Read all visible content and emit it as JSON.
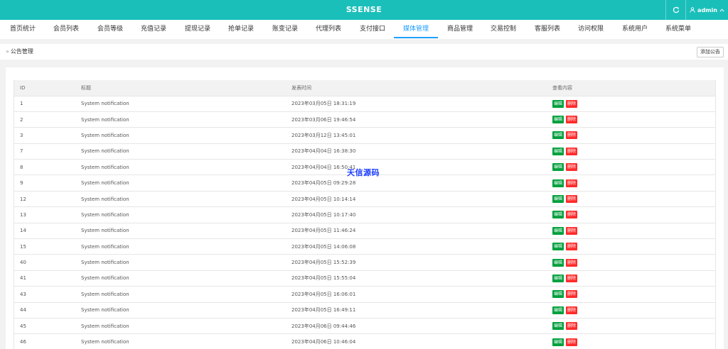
{
  "header": {
    "title": "SSENSE",
    "user_label": "admin",
    "accent_color": "#1bbfba",
    "icons": {
      "refresh": "refresh-icon",
      "user": "user-icon",
      "dropdown": "chevron-up-icon"
    }
  },
  "nav": {
    "active_color": "#1e9fff",
    "items": [
      {
        "label": "首页统计"
      },
      {
        "label": "会员列表"
      },
      {
        "label": "会员等级"
      },
      {
        "label": "充值记录"
      },
      {
        "label": "提现记录"
      },
      {
        "label": "抢单记录"
      },
      {
        "label": "账变记录"
      },
      {
        "label": "代理列表"
      },
      {
        "label": "支付接口"
      },
      {
        "label": "媒体管理"
      },
      {
        "label": "商品管理"
      },
      {
        "label": "交易控制"
      },
      {
        "label": "客服列表"
      },
      {
        "label": "访问权限"
      },
      {
        "label": "系统用户"
      },
      {
        "label": "系统菜单"
      }
    ],
    "active_index": 9
  },
  "breadcrumb": {
    "separator": "»",
    "current": "公告管理"
  },
  "toolbar": {
    "add_label": "添加公告"
  },
  "table": {
    "columns": [
      "ID",
      "标题",
      "发表时间",
      "查看内容"
    ],
    "edit_label": "编辑",
    "delete_label": "删除",
    "edit_color": "#009f3c",
    "delete_color": "#ff2b2b",
    "rows": [
      {
        "id": "1",
        "title": "System notification",
        "time": "2023年03月05日 18:31:19"
      },
      {
        "id": "2",
        "title": "System notification",
        "time": "2023年03月06日 19:46:54"
      },
      {
        "id": "3",
        "title": "System notification",
        "time": "2023年03月12日 13:45:01"
      },
      {
        "id": "7",
        "title": "System notification",
        "time": "2023年04月04日 16:38:30"
      },
      {
        "id": "8",
        "title": "System notification",
        "time": "2023年04月04日 16:50:41"
      },
      {
        "id": "9",
        "title": "System notification",
        "time": "2023年04月05日 09:29:28"
      },
      {
        "id": "12",
        "title": "System notification",
        "time": "2023年04月05日 10:14:14"
      },
      {
        "id": "13",
        "title": "System notification",
        "time": "2023年04月05日 10:17:40"
      },
      {
        "id": "14",
        "title": "System notification",
        "time": "2023年04月05日 11:46:24"
      },
      {
        "id": "15",
        "title": "System notification",
        "time": "2023年04月05日 14:06:08"
      },
      {
        "id": "40",
        "title": "System notification",
        "time": "2023年04月05日 15:52:39"
      },
      {
        "id": "41",
        "title": "System notification",
        "time": "2023年04月05日 15:55:04"
      },
      {
        "id": "43",
        "title": "System notification",
        "time": "2023年04月05日 16:06:01"
      },
      {
        "id": "44",
        "title": "System notification",
        "time": "2023年04月05日 16:49:11"
      },
      {
        "id": "45",
        "title": "System notification",
        "time": "2023年04月06日 09:44:46"
      },
      {
        "id": "46",
        "title": "System notification",
        "time": "2023年04月06日 10:46:04"
      }
    ]
  },
  "watermark": {
    "text": "天信源码"
  }
}
